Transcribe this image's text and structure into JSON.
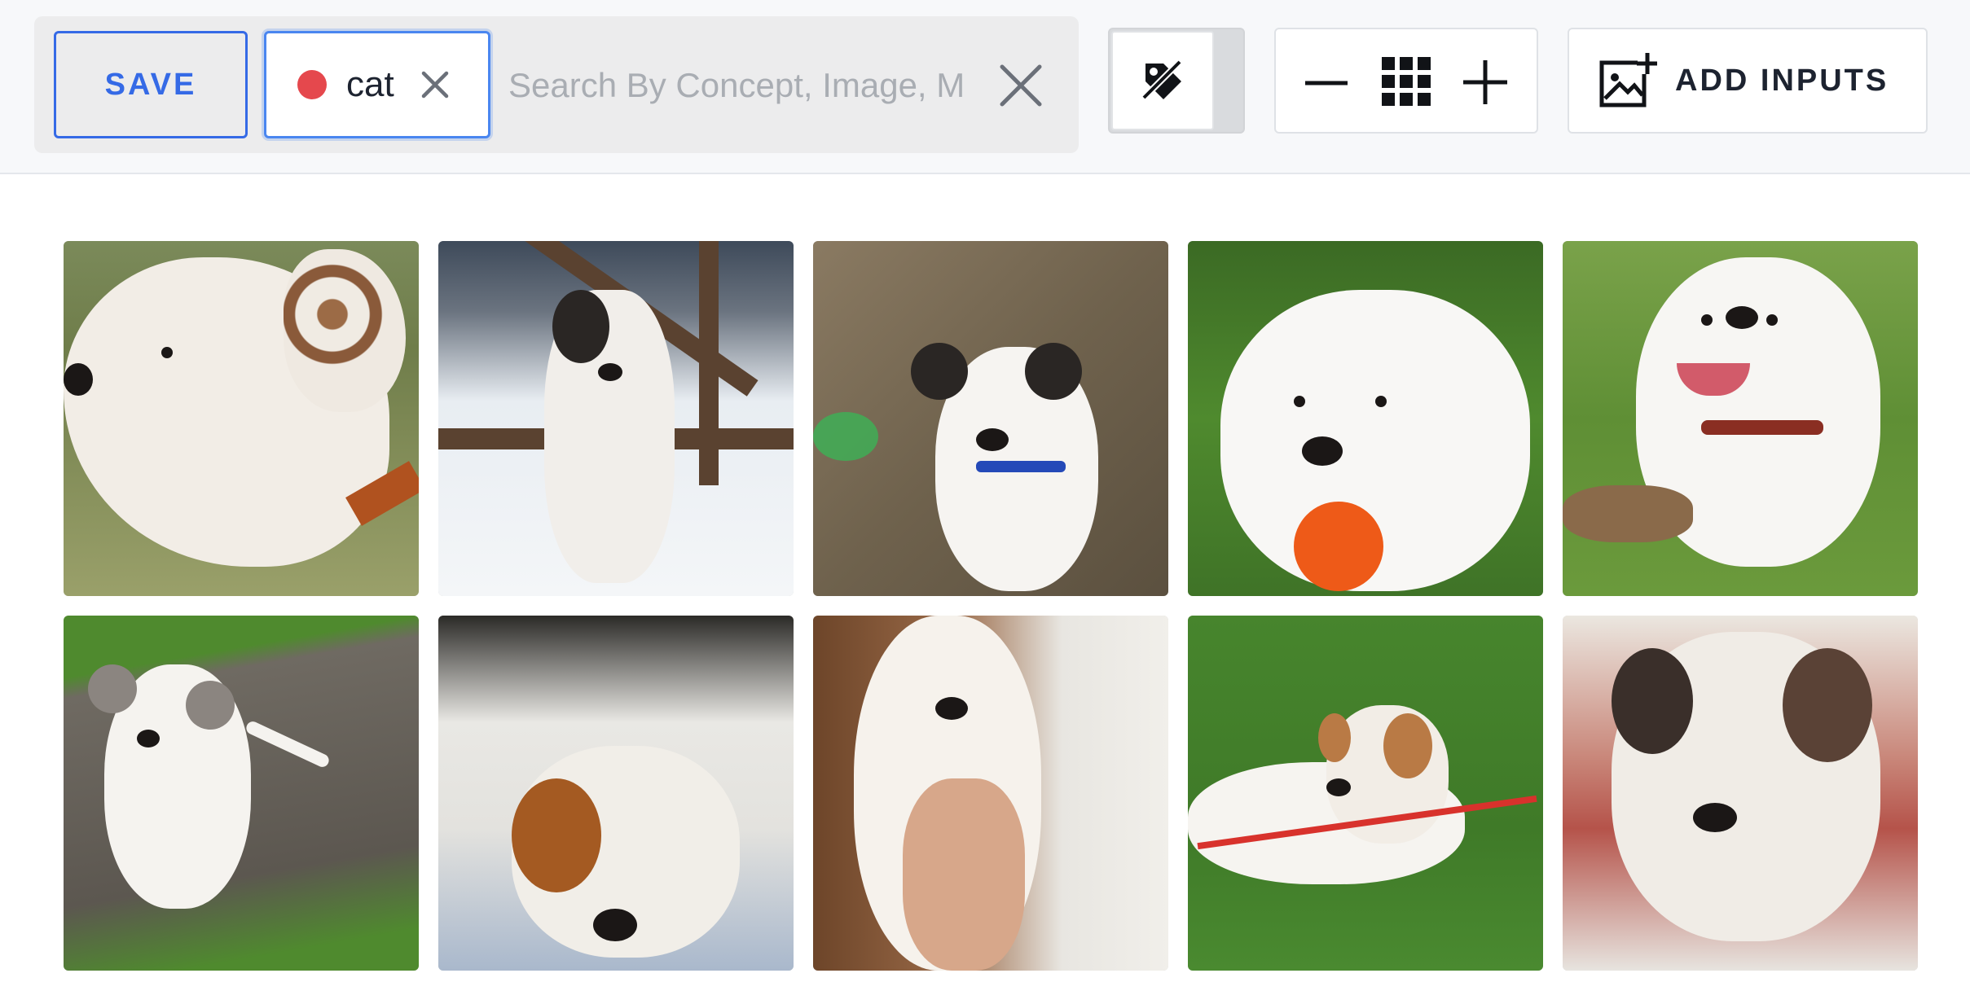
{
  "toolbar": {
    "save_label": "SAVE",
    "concept_chip": {
      "label": "cat",
      "dot_color": "#e5484d"
    },
    "search": {
      "placeholder": "Search By Concept, Image, M",
      "value": ""
    },
    "add_inputs_label": "ADD INPUTS"
  },
  "colors": {
    "accent": "#356ae6",
    "concept_dot": "#e5484d"
  },
  "icons": {
    "chip_remove": "close-icon",
    "search_clear": "close-icon",
    "toggle": "label-off-icon",
    "zoom_out": "minus-icon",
    "grid": "grid-icon",
    "zoom_in": "plus-icon",
    "add_inputs": "add-image-icon"
  },
  "gallery": {
    "tiles": [
      {
        "row": 1,
        "col": 1,
        "subject": "white dog head profile, brown collar"
      },
      {
        "row": 1,
        "col": 2,
        "subject": "puppy in snow by fence"
      },
      {
        "row": 1,
        "col": 3,
        "subject": "black and white puppy, blue collar"
      },
      {
        "row": 1,
        "col": 4,
        "subject": "white dog with orange toy on grass"
      },
      {
        "row": 1,
        "col": 5,
        "subject": "white dog with red collar on grass"
      },
      {
        "row": 2,
        "col": 1,
        "subject": "white puppy running on path"
      },
      {
        "row": 2,
        "col": 2,
        "subject": "bulldog lying on blankets"
      },
      {
        "row": 2,
        "col": 3,
        "subject": "white puppy held in hands"
      },
      {
        "row": 2,
        "col": 4,
        "subject": "brown and white dog on grass with red leash"
      },
      {
        "row": 2,
        "col": 5,
        "subject": "bulldog lying on floor"
      }
    ]
  }
}
